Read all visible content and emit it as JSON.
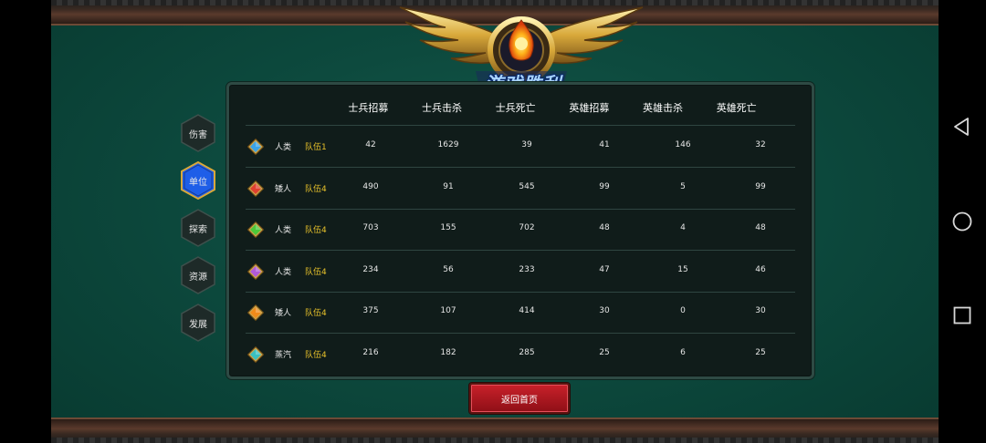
{
  "title": "游戏胜利",
  "tabs": [
    {
      "label": "伤害",
      "active": false
    },
    {
      "label": "单位",
      "active": true
    },
    {
      "label": "探索",
      "active": false
    },
    {
      "label": "资源",
      "active": false
    },
    {
      "label": "发展",
      "active": false
    }
  ],
  "columns": [
    "士兵招募",
    "士兵击杀",
    "士兵死亡",
    "英雄招募",
    "英雄击杀",
    "英雄死亡"
  ],
  "rows": [
    {
      "gem_color": "#3aa3e8",
      "race": "人类",
      "team": "队伍1",
      "values": [
        "42",
        "1629",
        "39",
        "41",
        "146",
        "32"
      ]
    },
    {
      "gem_color": "#e04030",
      "race": "矮人",
      "team": "队伍4",
      "values": [
        "490",
        "91",
        "545",
        "99",
        "5",
        "99"
      ]
    },
    {
      "gem_color": "#4cc83a",
      "race": "人类",
      "team": "队伍4",
      "values": [
        "703",
        "155",
        "702",
        "48",
        "4",
        "48"
      ]
    },
    {
      "gem_color": "#b05ad8",
      "race": "人类",
      "team": "队伍4",
      "values": [
        "234",
        "56",
        "233",
        "47",
        "15",
        "46"
      ]
    },
    {
      "gem_color": "#f08a1a",
      "race": "矮人",
      "team": "队伍4",
      "values": [
        "375",
        "107",
        "414",
        "30",
        "0",
        "30"
      ]
    },
    {
      "gem_color": "#3ac0c0",
      "race": "蒸汽",
      "team": "队伍4",
      "values": [
        "216",
        "182",
        "285",
        "25",
        "6",
        "25"
      ]
    }
  ],
  "return_button": "返回首页",
  "colors": {
    "team_text": "#e8c22a",
    "active_tab": "#1e5ee8",
    "return_button": "#c9212a"
  }
}
